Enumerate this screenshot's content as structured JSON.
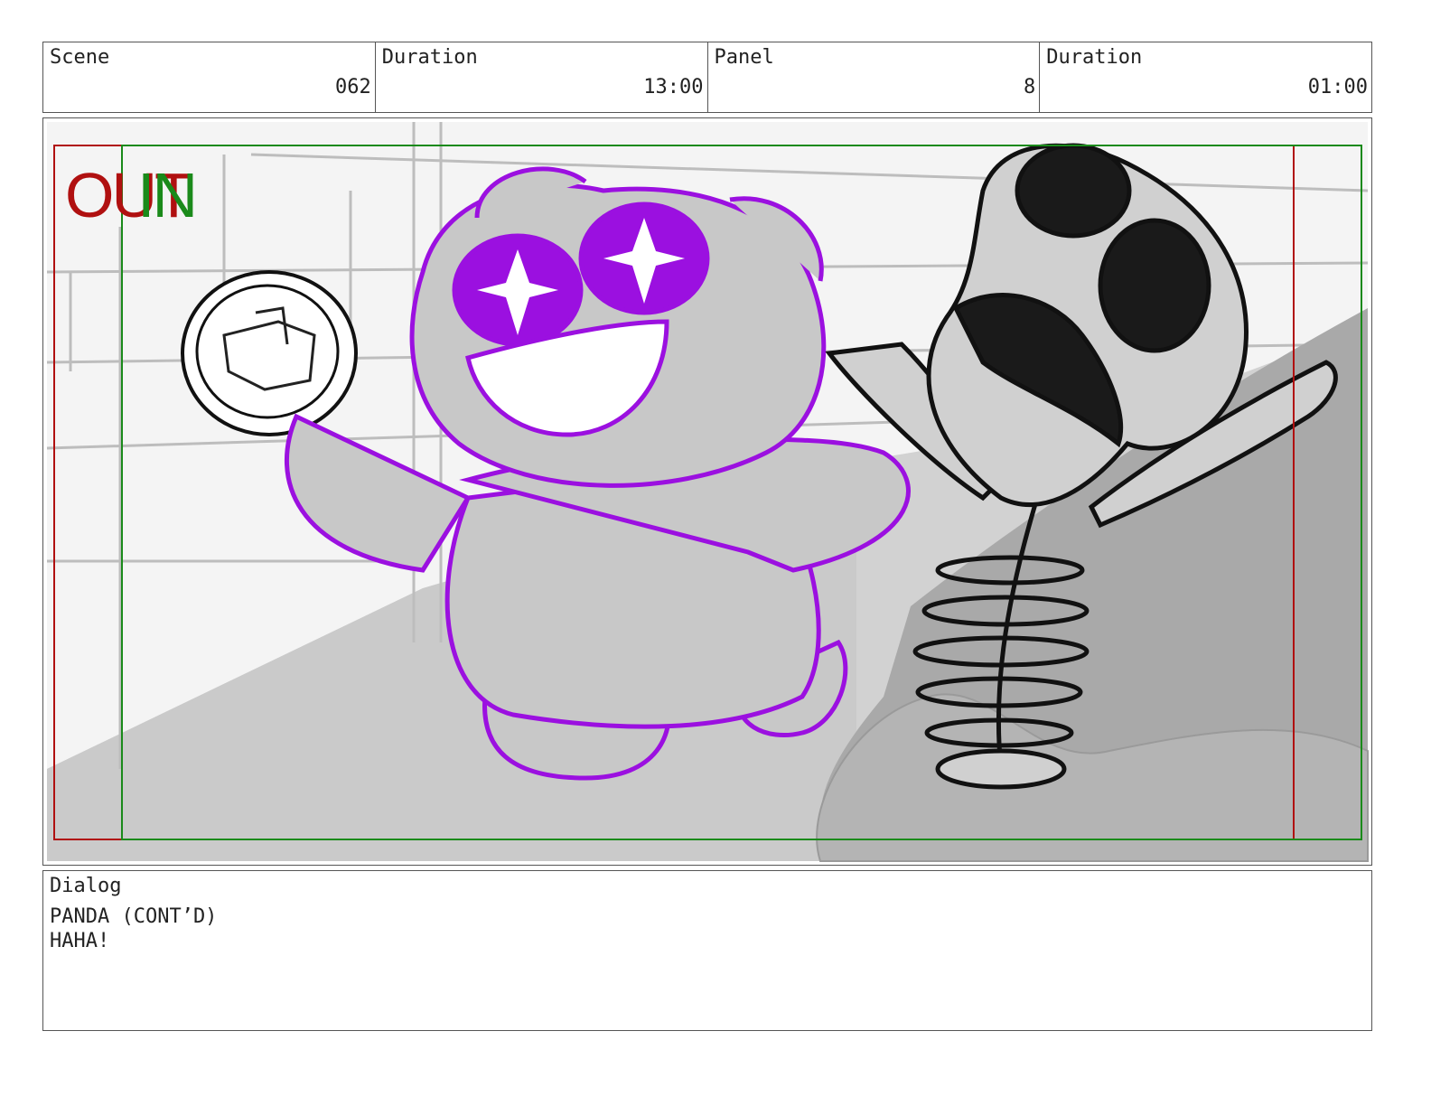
{
  "header": {
    "scene": {
      "label": "Scene",
      "value": "062"
    },
    "duration": {
      "label": "Duration",
      "value": "13:00"
    },
    "panel": {
      "label": "Panel",
      "value": "8"
    },
    "panel_duration": {
      "label": "Duration",
      "value": "01:00"
    }
  },
  "frame": {
    "out_label": "OUT",
    "in_label": "IN",
    "colors": {
      "out_guide": "#b01010",
      "in_guide": "#1a8a1a",
      "panda_line": "#9b10e0",
      "panda_fill": "#c8c8c8",
      "background": "#d2d2d2"
    }
  },
  "dialog": {
    "label": "Dialog",
    "speaker": "PANDA (CONT’D)",
    "line": "HAHA!"
  }
}
